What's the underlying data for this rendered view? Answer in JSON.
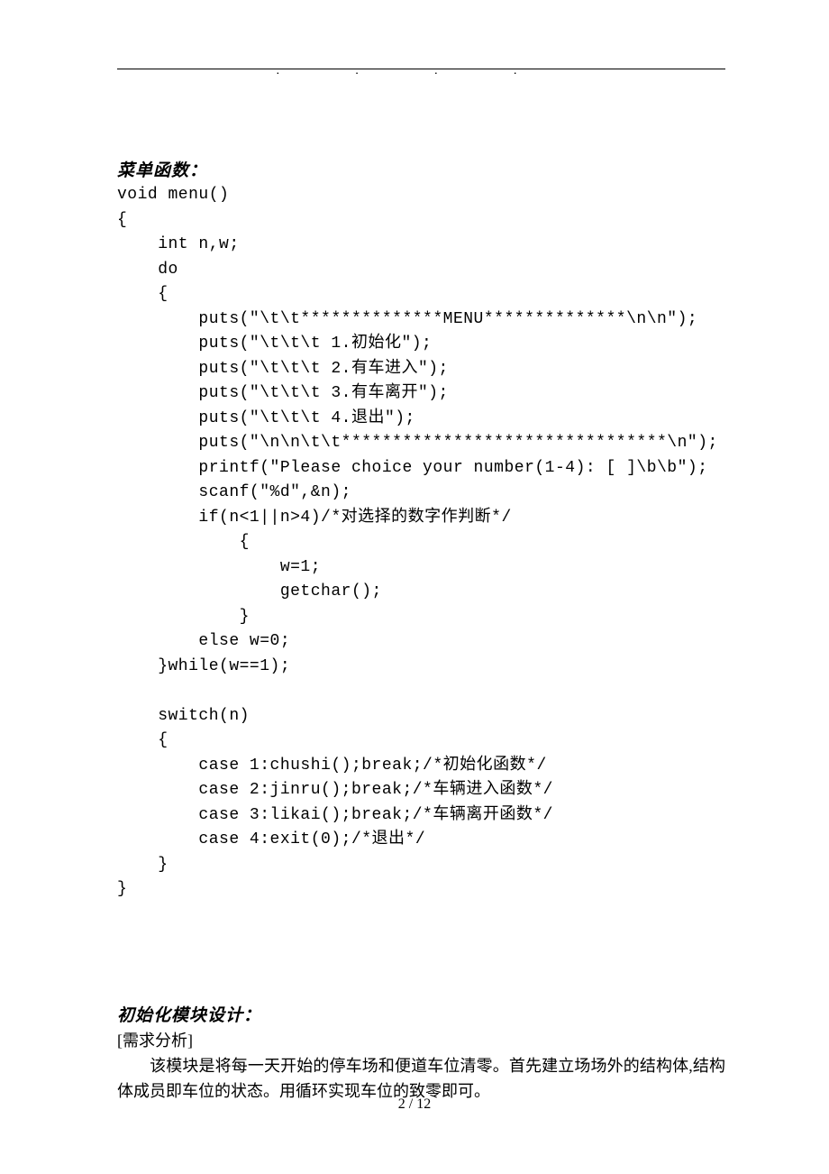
{
  "heading1": "菜单函数：",
  "code": "void menu()\n{\n    int n,w;\n    do\n    {\n        puts(\"\\t\\t**************MENU**************\\n\\n\");\n        puts(\"\\t\\t\\t 1.初始化\");\n        puts(\"\\t\\t\\t 2.有车进入\");\n        puts(\"\\t\\t\\t 3.有车离开\");\n        puts(\"\\t\\t\\t 4.退出\");\n        puts(\"\\n\\n\\t\\t********************************\\n\");\n        printf(\"Please choice your number(1-4): [ ]\\b\\b\");\n        scanf(\"%d\",&n);\n        if(n<1||n>4)/*对选择的数字作判断*/\n            {\n                w=1;\n                getchar();\n            }\n        else w=0;\n    }while(w==1);\n\n    switch(n)\n    {\n        case 1:chushi();break;/*初始化函数*/\n        case 2:jinru();break;/*车辆进入函数*/\n        case 3:likai();break;/*车辆离开函数*/\n        case 4:exit(0);/*退出*/\n    }\n}",
  "heading2": "初始化模块设计：",
  "req_label": "[需求分析]",
  "paragraph": "该模块是将每一天开始的停车场和便道车位清零。首先建立场场外的结构体,结构体成员即车位的状态。用循环实现车位的致零即可。",
  "footer": "2 / 12",
  "rule_dots": ".   .      .   ."
}
